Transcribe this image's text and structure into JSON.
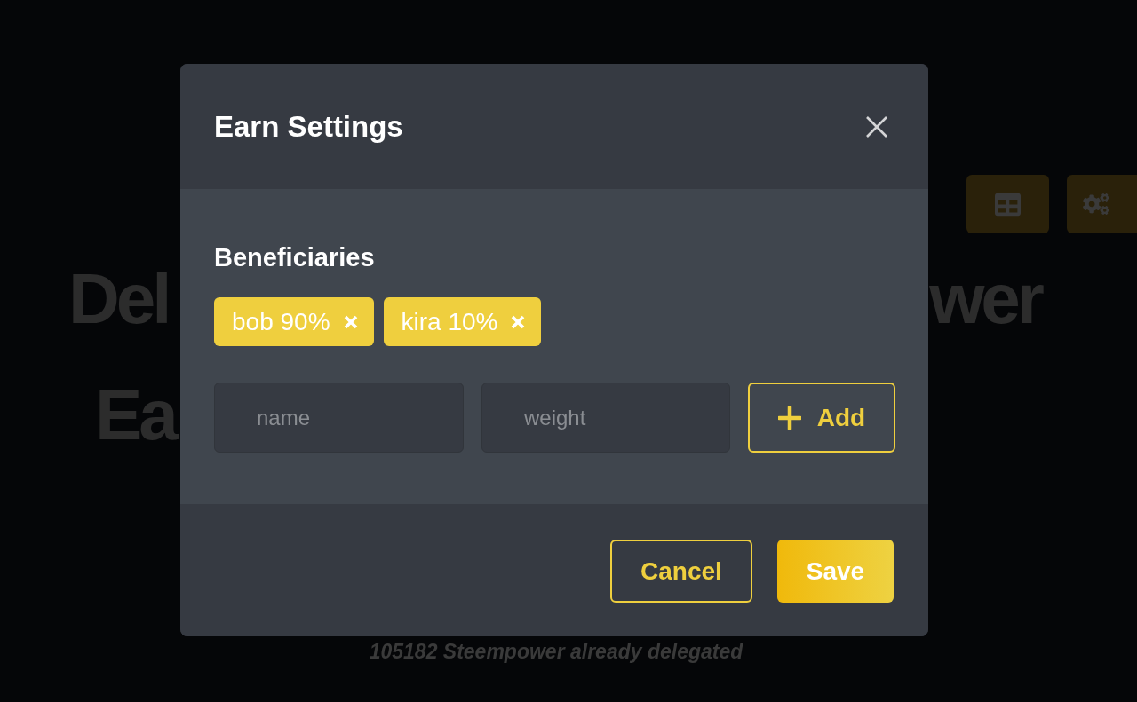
{
  "background_page": {
    "heading": {
      "line_1_left": "Del",
      "line_1_right": "wer",
      "line_2_left": "Ea"
    },
    "note": "105182 Steempower already delegated"
  },
  "dialog": {
    "title": "Earn Settings",
    "section_title": "Beneficiaries",
    "beneficiaries": [
      {
        "label": "bob 90%"
      },
      {
        "label": "kira 10%"
      }
    ],
    "name_field": {
      "placeholder": "name"
    },
    "weight_field": {
      "placeholder": "weight"
    },
    "add_button": "Add",
    "buttons": [
      {
        "label": "Cancel",
        "kind": "secondary"
      },
      {
        "label": "Save",
        "kind": "primary"
      }
    ]
  }
}
